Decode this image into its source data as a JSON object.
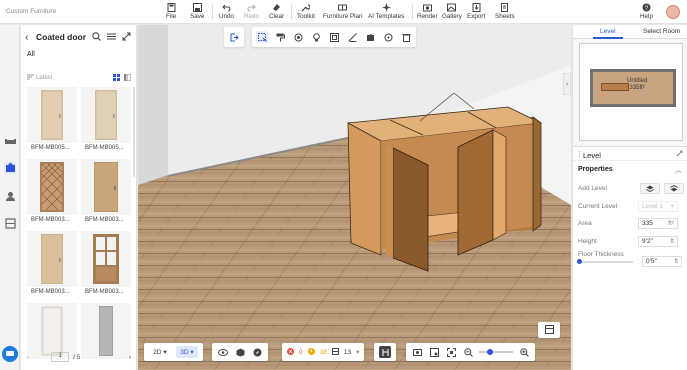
{
  "app": {
    "title": "Custom Furniture"
  },
  "toolbar": {
    "file": "File",
    "save": "Save",
    "undo": "Undo",
    "redo": "Redo",
    "clear": "Clear",
    "toolkit": "Toolkit",
    "furniture_plan": "Furniture Plan",
    "ai_templates": "AI Templates",
    "render": "Render",
    "gallery": "Gallery",
    "export": "Export",
    "sheets": "Sheets",
    "help": "Help"
  },
  "catalog": {
    "title": "Coated door",
    "filter_all": "All",
    "sort_label": "Latest",
    "items": [
      {
        "name": "BFM-MB005..."
      },
      {
        "name": "BFM-MB005..."
      },
      {
        "name": "BFM-MB003..."
      },
      {
        "name": "BFM-MB003..."
      },
      {
        "name": "BFM-MB003..."
      },
      {
        "name": "BFM-MB003..."
      },
      {
        "name": ""
      },
      {
        "name": ""
      }
    ],
    "page_current": "1",
    "page_total": "/ 5"
  },
  "bottom_bar": {
    "mode_2d": "2D",
    "mode_3d": "3D",
    "errors": "0",
    "warnings": "38",
    "count": "13"
  },
  "right_panel": {
    "tab_level": "Level",
    "tab_select_room": "Select Room",
    "map_room_name": "Untitled",
    "map_room_area": "335ft²"
  },
  "level_panel": {
    "title": "Level",
    "properties_label": "Properties",
    "add_level_label": "Add Level",
    "current_level_label": "Current Level",
    "current_level_value": "Level 1",
    "area_label": "Area",
    "area_value": "335",
    "area_unit": "ft²",
    "height_label": "Height",
    "height_value": "9'2\"",
    "height_unit": "ft",
    "floor_thickness_label": "Floor Thickness",
    "floor_thickness_value": "0'5\"",
    "floor_thickness_unit": "ft"
  },
  "colors": {
    "accent": "#2a56d6",
    "wood": "#c9945c",
    "dark_wood": "#7a4a28"
  }
}
